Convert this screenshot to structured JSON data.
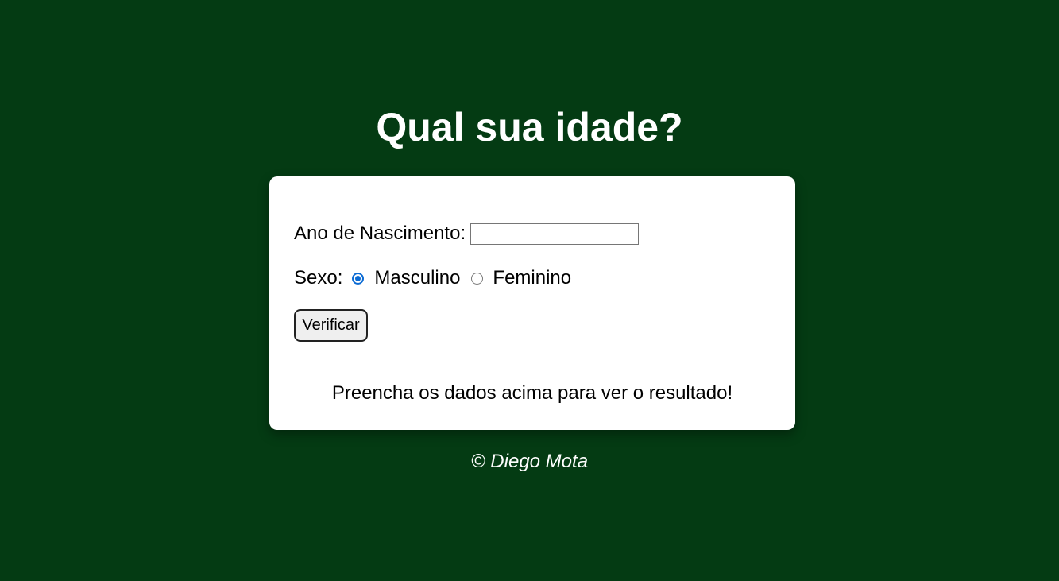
{
  "page": {
    "title": "Qual sua idade?",
    "background_color": "#043b13"
  },
  "form": {
    "birth_year_label": "Ano de Nascimento:",
    "birth_year_value": "",
    "sex_label": "Sexo:",
    "sex_options": [
      {
        "label": "Masculino",
        "checked": true
      },
      {
        "label": "Feminino",
        "checked": false
      }
    ],
    "submit_label": "Verificar",
    "result_text": "Preencha os dados acima para ver o resultado!"
  },
  "footer": {
    "copyright": "© Diego Mota"
  },
  "colors": {
    "radio_accent": "#0b6bd4"
  }
}
